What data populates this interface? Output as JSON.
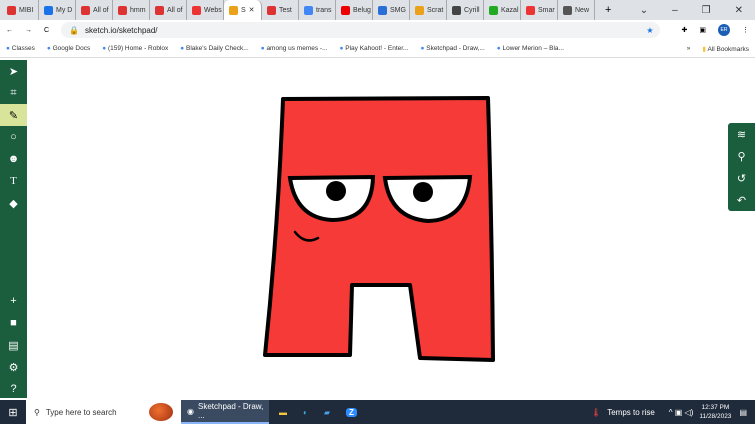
{
  "tabs": [
    {
      "label": "MIBI",
      "color": "#d33"
    },
    {
      "label": "My D",
      "color": "#1a73e8"
    },
    {
      "label": "All of",
      "color": "#d33"
    },
    {
      "label": "hmm",
      "color": "#d33"
    },
    {
      "label": "All of",
      "color": "#d33"
    },
    {
      "label": "Webs",
      "color": "#e33"
    },
    {
      "label": "S",
      "color": "#e9a21a",
      "active": true
    },
    {
      "label": "Test",
      "color": "#d33"
    },
    {
      "label": "trans",
      "color": "#4285f4"
    },
    {
      "label": "Belug",
      "color": "#e00"
    },
    {
      "label": "SMG",
      "color": "#2a6fd6"
    },
    {
      "label": "Scrat",
      "color": "#e9a21a"
    },
    {
      "label": "Cyrill",
      "color": "#444"
    },
    {
      "label": "Kazal",
      "color": "#2a2"
    },
    {
      "label": "Smar",
      "color": "#e33"
    },
    {
      "label": "New",
      "color": "#555"
    }
  ],
  "url": "sketch.io/sketchpad/",
  "profile": "ER",
  "bookmarks": [
    "Classes",
    "Google Docs",
    "(159) Home - Roblox",
    "Blake's Daily Check...",
    "among us memes -...",
    "Play Kahoot! - Enter...",
    "Sketchpad - Draw,...",
    "Lower Merion – Bla..."
  ],
  "all_bookmarks": "All Bookmarks",
  "taskbar": {
    "search_placeholder": "Type here to search",
    "app": "Sketchpad - Draw, ...",
    "weather": "Temps to rise",
    "time": "12:37 PM",
    "date": "11/28/2023"
  },
  "colors": {
    "letter": "#f53a38",
    "toolbar": "#1b5e3d",
    "selected_tool": "#d7e49a"
  }
}
